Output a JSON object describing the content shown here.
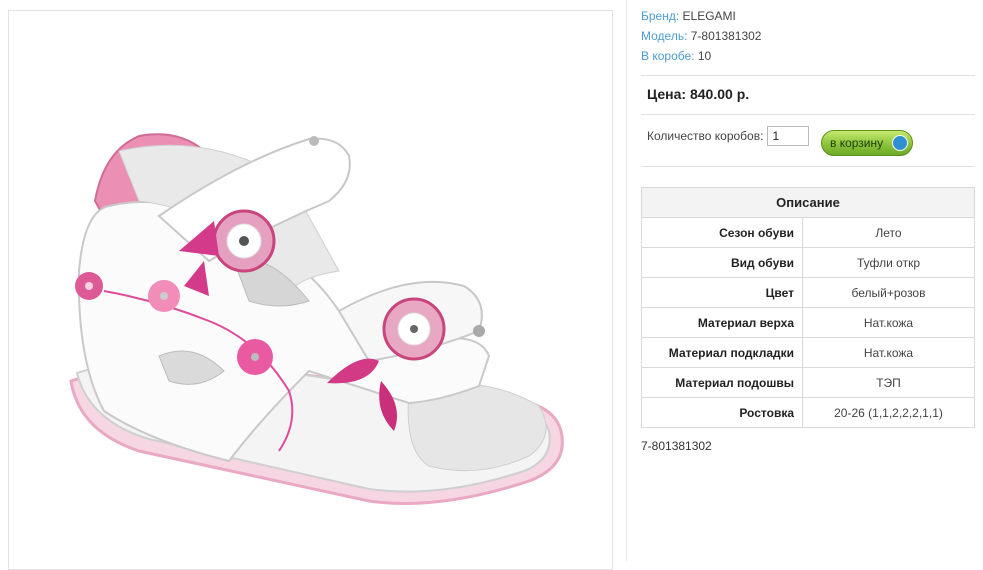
{
  "product": {
    "brand_label": "Бренд:",
    "brand": "ELEGAMI",
    "model_label": "Модель:",
    "model": "7-801381302",
    "box_label": "В коробе:",
    "box_count": "10"
  },
  "price": {
    "text": "Цена: 840.00 р."
  },
  "order": {
    "qty_label": "Количество коробов:",
    "qty_value": "1",
    "cart_label": "в корзину"
  },
  "description": {
    "title": "Описание",
    "rows": [
      {
        "key": "Сезон обуви",
        "value": "Лето"
      },
      {
        "key": "Вид обуви",
        "value": "Туфли откр"
      },
      {
        "key": "Цвет",
        "value": "белый+розов"
      },
      {
        "key": "Материал верха",
        "value": "Нат.кожа"
      },
      {
        "key": "Материал подкладки",
        "value": "Нат.кожа"
      },
      {
        "key": "Материал подошвы",
        "value": "ТЭП"
      },
      {
        "key": "Ростовка",
        "value": "20-26 (1,1,2,2,2,1,1)"
      }
    ]
  },
  "footer_code": "7-801381302",
  "colors": {
    "accent_link": "#4a9bd1",
    "cart_green": "#8cc43a",
    "pink": "#e04a9a"
  }
}
